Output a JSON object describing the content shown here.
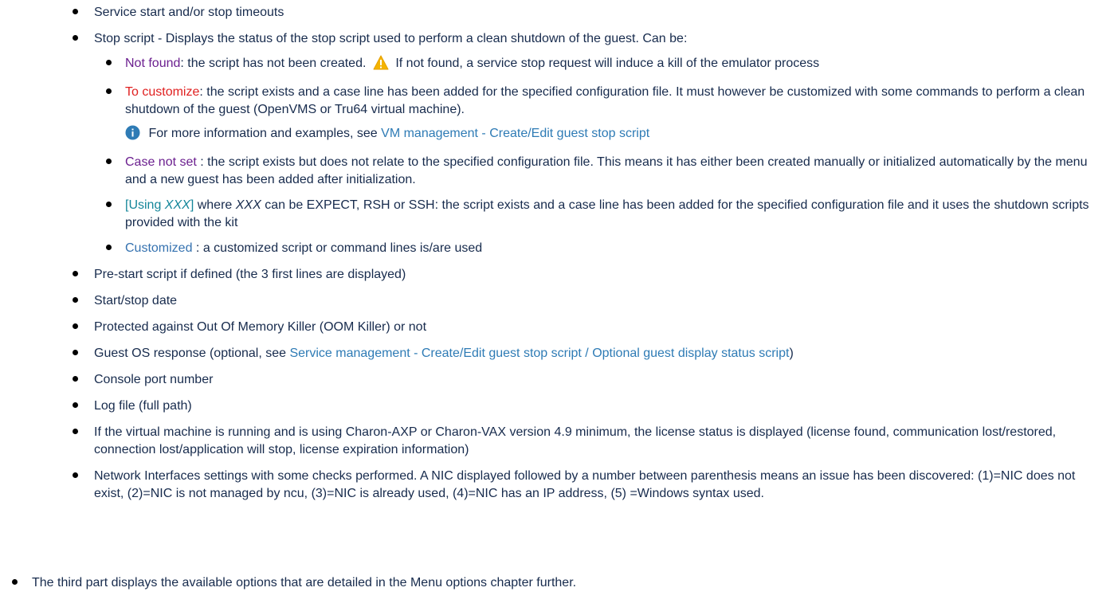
{
  "items": {
    "timeouts": "Service start and/or stop timeouts",
    "stop_script_intro": "Stop script - Displays the status of the stop script used to perform a clean shutdown of the guest. Can be:",
    "pre_start": "Pre-start script if defined (the 3 first lines are displayed)",
    "start_stop_date": "Start/stop date",
    "oom": "Protected against Out Of Memory Killer (OOM Killer) or not",
    "guest_os_prefix": "Guest OS response (optional, see ",
    "guest_os_link": "Service management - Create/Edit guest stop script / Optional guest display status script",
    "guest_os_suffix": ")",
    "console_port": "Console port number",
    "log_file": "Log file (full path)",
    "license_status": "If the virtual machine is running and is using Charon-AXP or Charon-VAX version 4.9 minimum, the license status is displayed (license found, communication lost/restored, connection lost/application will stop, license expiration information)",
    "network": "Network Interfaces settings with some checks performed. A NIC displayed followed by a number between parenthesis means an issue has been discovered: (1)=NIC does not exist, (2)=NIC is not managed by ncu, (3)=NIC is already used, (4)=NIC has an IP address, (5) =Windows syntax used."
  },
  "stop_script_states": {
    "not_found": {
      "label": "Not found",
      "text": ": the script has not been created.",
      "warning": "If not found, a service stop request will induce a kill of the emulator process"
    },
    "to_customize": {
      "label": "To customize",
      "text": ": the script exists and a case line has been added for the specified configuration file. It must however be customized with some commands to perform a clean shutdown of the guest (OpenVMS or Tru64 virtual machine).",
      "info_prefix": "For more information and examples, see ",
      "info_link": "VM management - Create/Edit guest stop script"
    },
    "case_not_set": {
      "label": "Case not set",
      "text": " : the script exists but does not relate to the specified configuration file. This means it has either been created manually or initialized automatically by the menu and a new guest has been added after initialization."
    },
    "using_xxx": {
      "label_open": "[Using ",
      "label_var": "XXX",
      "label_close": "]",
      "text_where": " where ",
      "text_var": "XXX",
      "text": " can be EXPECT, RSH or SSH: the script exists and a case line has been added for the specified configuration file and it uses the shutdown scripts provided with the kit"
    },
    "customized": {
      "label": "Customized",
      "text": " : a customized script or command lines is/are used"
    }
  },
  "third_part": "The third part displays the available options that are detailed in the Menu options chapter further.",
  "colors": {
    "not_found": "#6b1f8f",
    "to_customize": "#e02020",
    "case_not_set": "#6b1f8f",
    "using": "#14869a",
    "customized": "#3572b0",
    "link": "#2e7bb5",
    "warning_icon": "#f4b400",
    "info_icon": "#2e7bb5"
  },
  "icons": {
    "warning": "warning-triangle-icon",
    "info": "info-circle-icon"
  }
}
